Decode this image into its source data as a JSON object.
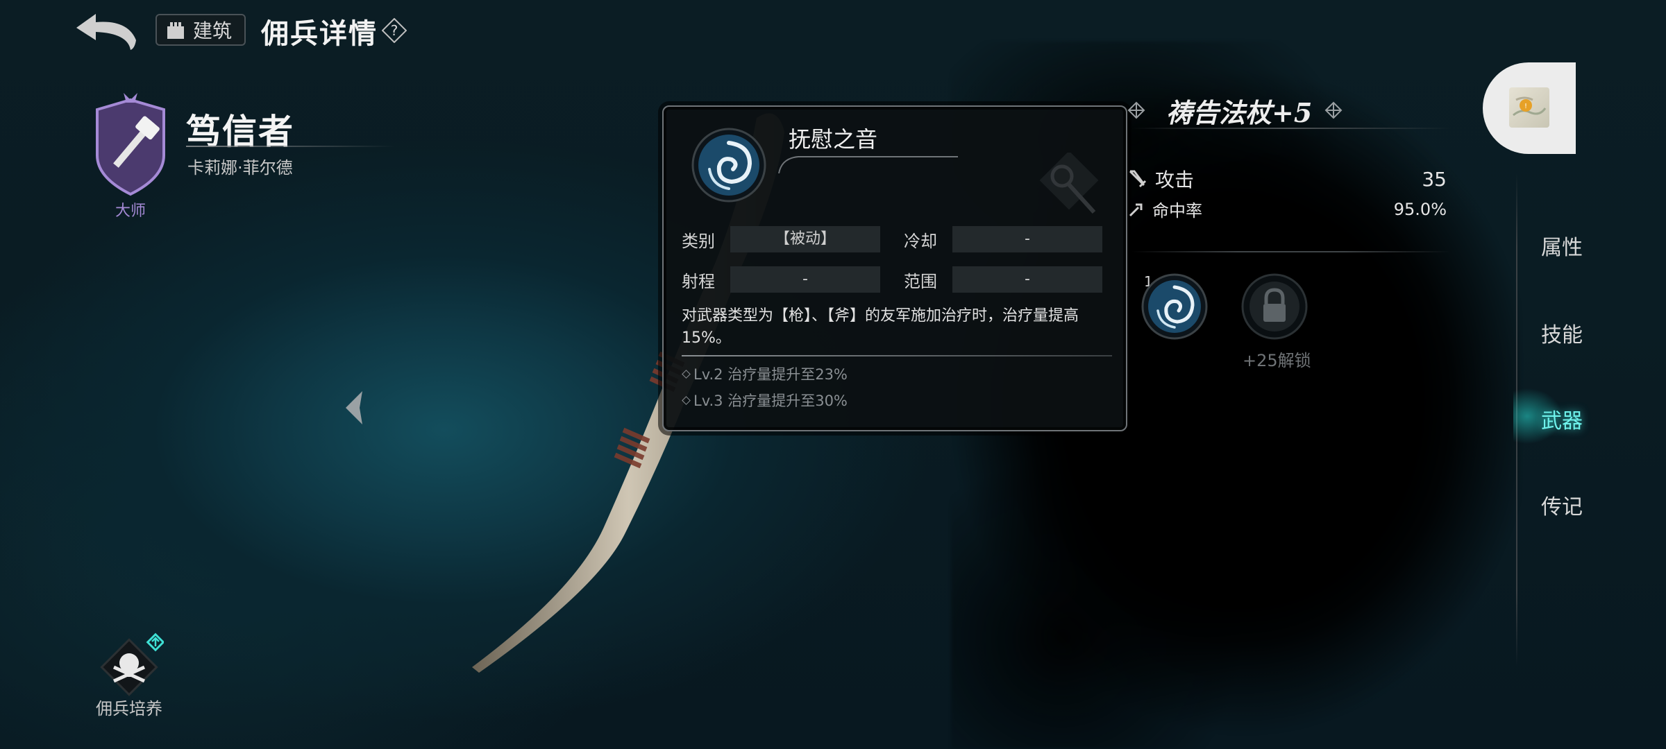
{
  "header": {
    "back_icon": "back-arrow-icon",
    "building_label": "建筑",
    "page_title": "佣兵详情",
    "help_label": "?"
  },
  "hero": {
    "name": "笃信者",
    "subtitle": "卡莉娜·菲尔德",
    "rank": "大师",
    "rank_color": "#a58ad6",
    "training_label": "佣兵培养"
  },
  "skill_popup": {
    "title": "抚慰之音",
    "rows": [
      {
        "label": "类别",
        "value": "【被动】",
        "label2": "冷却",
        "value2": "-"
      },
      {
        "label": "射程",
        "value": "-",
        "label2": "范围",
        "value2": "-"
      }
    ],
    "description": "对武器类型为【枪】、【斧】的友军施加治疗时，治疗量提高15%。",
    "levels": [
      "Lv.2 治疗量提升至23%",
      "Lv.3 治疗量提升至30%"
    ]
  },
  "weapon": {
    "name": "祷告法杖+5",
    "stats": [
      {
        "icon": "sword-icon",
        "label": "攻击",
        "value": "35"
      },
      {
        "icon": "accuracy-icon",
        "label": "命中率",
        "value": "95.0%"
      }
    ],
    "slot_number": "1",
    "unlock_text": "+25解锁"
  },
  "tabs": [
    {
      "label": "属性",
      "active": false
    },
    {
      "label": "技能",
      "active": false
    },
    {
      "label": "武器",
      "active": true
    },
    {
      "label": "传记",
      "active": false
    }
  ],
  "colors": {
    "accent": "#6ff3ec",
    "rank": "#a58ad6"
  }
}
